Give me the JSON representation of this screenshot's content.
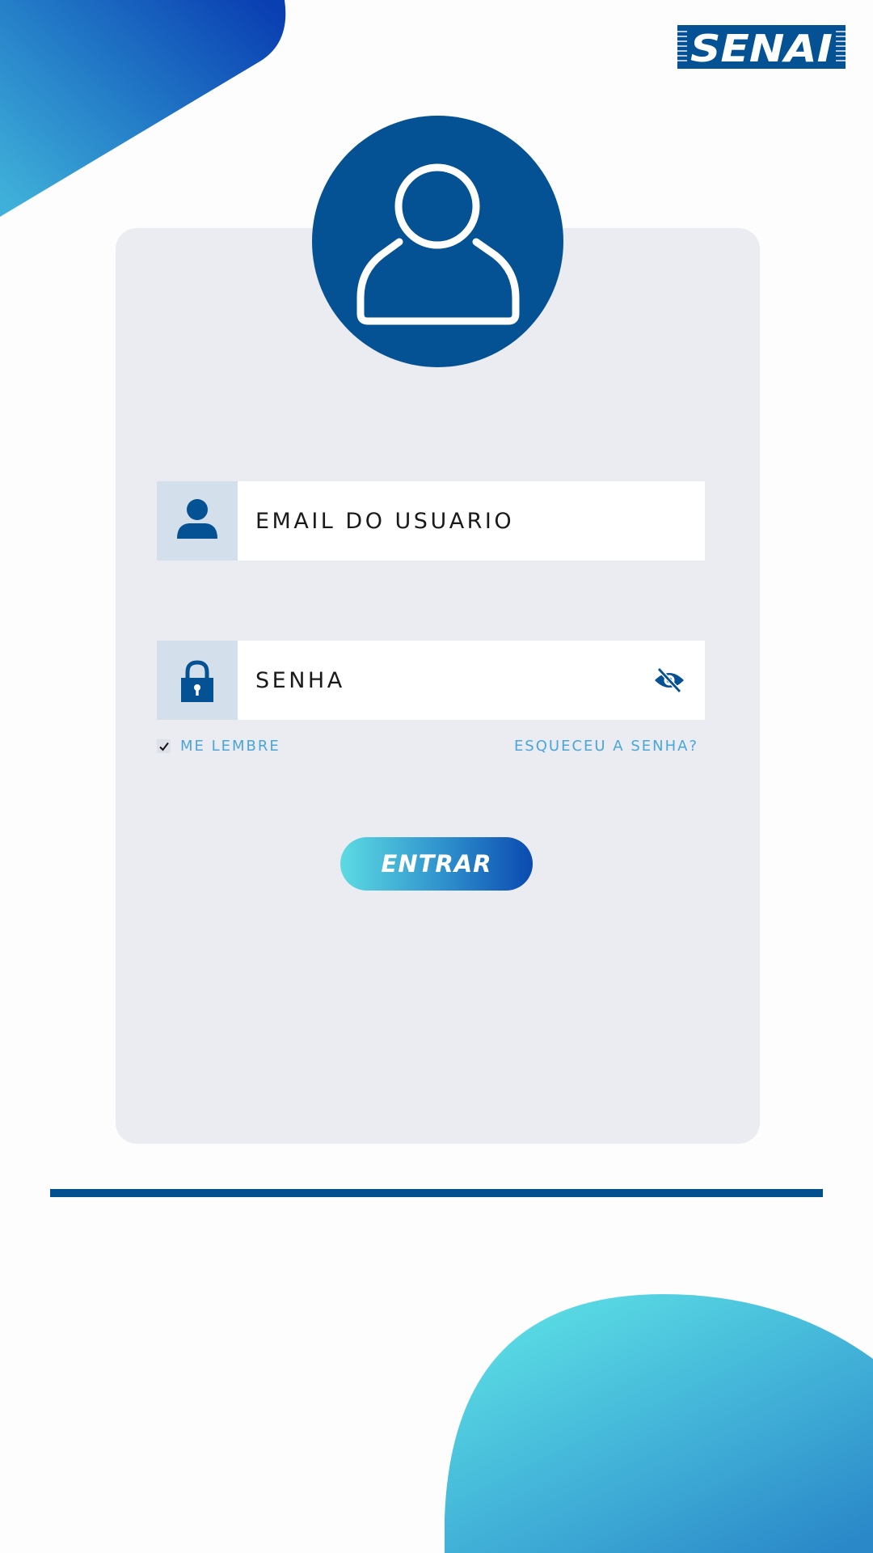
{
  "brand": {
    "logo_text": "SENAI",
    "primary_color": "#045193",
    "accent_gradient": [
      "#5cdbe2",
      "#0a4ab0"
    ]
  },
  "card": {
    "avatar_icon": "user-outline-icon"
  },
  "form": {
    "email_label": "EMAIL DO USUARIO",
    "email_icon": "user-icon",
    "password_label": "SENHA",
    "password_icon": "lock-icon",
    "password_toggle_icon": "eye-slash-icon",
    "remember_label": "ME LEMBRE",
    "remember_checked": true,
    "forgot_label": "ESQUECEU A SENHA?",
    "submit_label": "ENTRAR"
  }
}
